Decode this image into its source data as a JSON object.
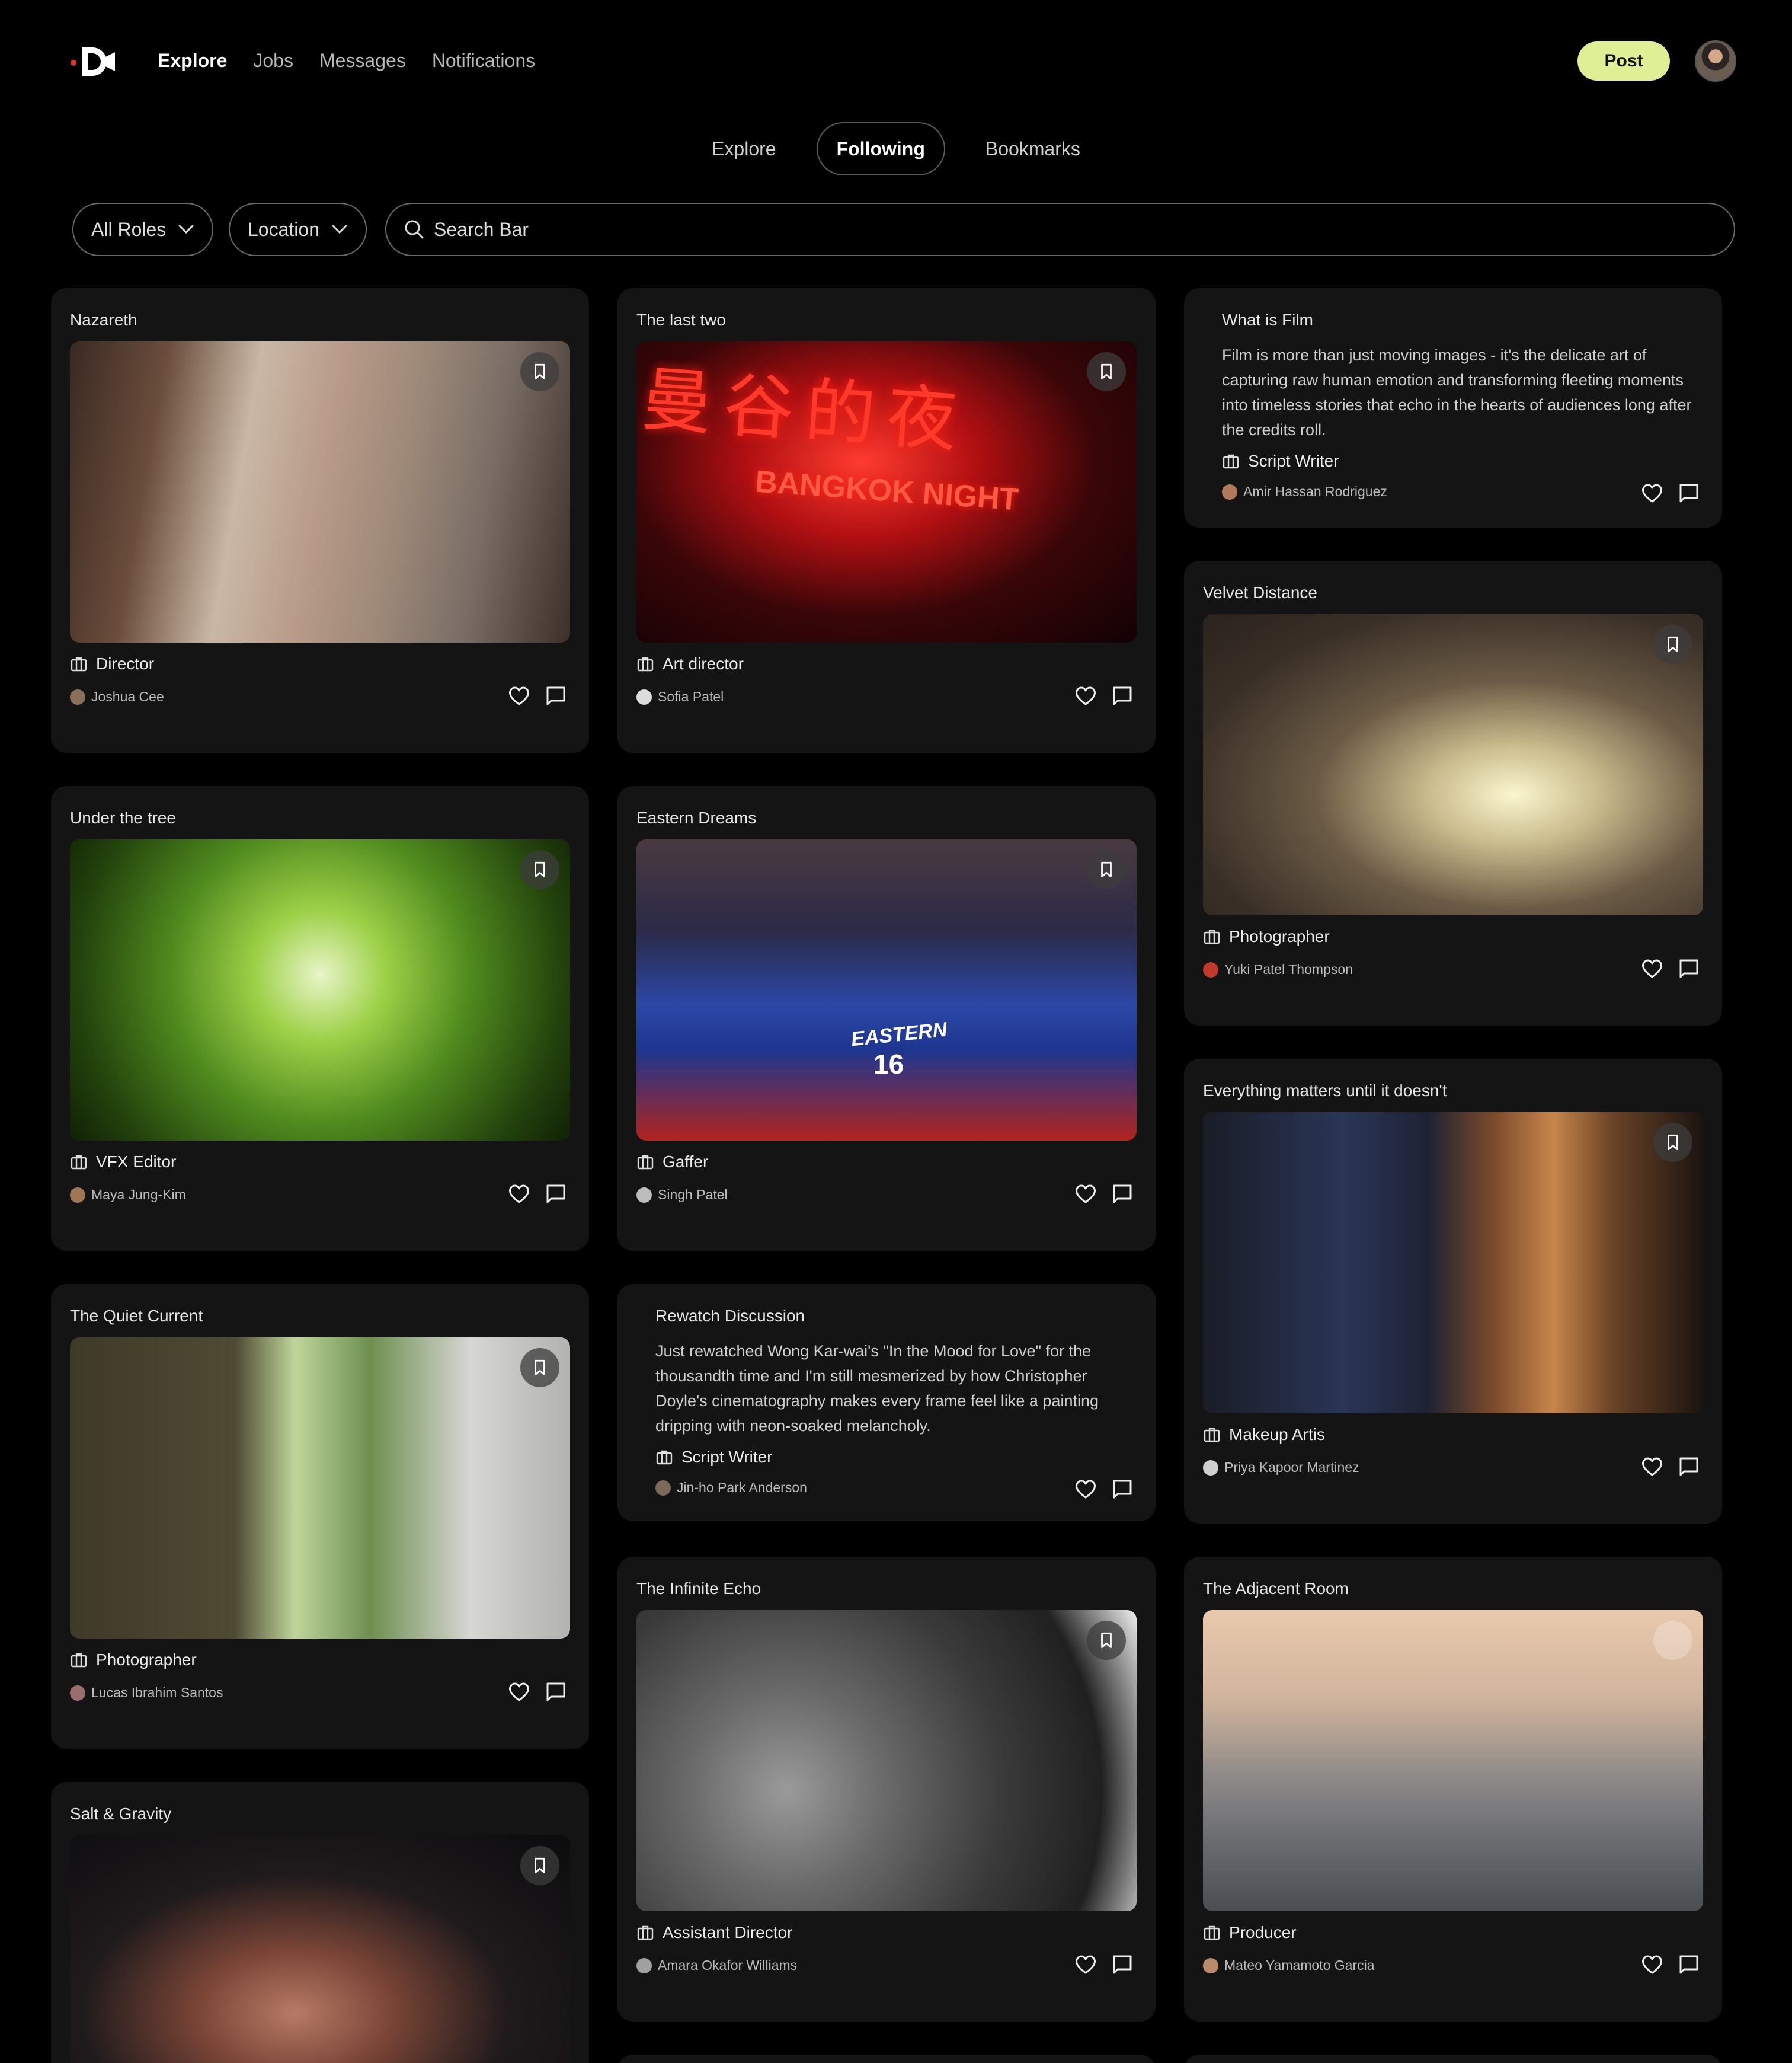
{
  "header": {
    "brand": "D",
    "nav": [
      {
        "label": "Explore",
        "active": true
      },
      {
        "label": "Jobs",
        "active": false
      },
      {
        "label": "Messages",
        "active": false
      },
      {
        "label": "Notifications",
        "active": false
      }
    ],
    "post_label": "Post"
  },
  "tabs": [
    {
      "label": "Explore",
      "active": false
    },
    {
      "label": "Following",
      "active": true
    },
    {
      "label": "Bookmarks",
      "active": false
    }
  ],
  "filters": {
    "roles_label": "All Roles",
    "location_label": "Location",
    "search_placeholder": "Search Bar"
  },
  "cards": {
    "nazareth": {
      "title": "Nazareth",
      "role": "Director",
      "author": "Joshua Cee"
    },
    "last_two": {
      "title": "The last two",
      "role": "Art director",
      "author": "Sofia Patel"
    },
    "what_is_film": {
      "title": "What is Film",
      "body": "Film is more than just moving images - it's the delicate art of capturing raw human emotion and transforming fleeting moments into timeless stories that echo in the hearts of audiences long after the credits roll.",
      "role": "Script Writer",
      "author": "Amir Hassan Rodriguez"
    },
    "velvet": {
      "title": "Velvet Distance",
      "role": "Photographer",
      "author": "Yuki Patel Thompson"
    },
    "tree": {
      "title": "Under the tree",
      "role": "VFX Editor",
      "author": "Maya Jung-Kim"
    },
    "eastern": {
      "title": "Eastern Dreams",
      "role": "Gaffer",
      "author": "Singh Patel"
    },
    "everything": {
      "title": "Everything matters until it doesn't",
      "role": "Makeup Artis",
      "author": "Priya Kapoor Martinez"
    },
    "quiet": {
      "title": "The Quiet Current",
      "role": "Photographer",
      "author": "Lucas Ibrahim Santos"
    },
    "rewatch": {
      "title": "Rewatch Discussion",
      "body": "Just rewatched Wong Kar-wai's \"In the Mood for Love\" for the thousandth time and I'm still mesmerized by how Christopher Doyle's cinematography makes every frame feel like a painting dripping with neon-soaked melancholy.",
      "role": "Script Writer",
      "author": "Jin-ho Park Anderson"
    },
    "echo": {
      "title": "The Infinite Echo",
      "role": "Assistant Director",
      "author": "Amara Okafor Williams"
    },
    "adjacent": {
      "title": "The Adjacent Room",
      "role": "Producer",
      "author": "Mateo Yamamoto Garcia"
    },
    "salt": {
      "title": "Salt & Gravity"
    }
  },
  "image_text": {
    "bangkok_chinese": "曼谷的夜",
    "bangkok_sign": "BANGKOK NIGHT",
    "jersey_team": "EASTERN",
    "jersey_number": "16"
  },
  "colors": {
    "background": "#000000",
    "card": "#141414",
    "accent": "#dfef96",
    "logo_dot": "#e0312b"
  },
  "icons": [
    "bookmark-icon",
    "heart-icon",
    "comment-icon",
    "briefcase-icon",
    "chevron-down-icon",
    "search-icon"
  ]
}
